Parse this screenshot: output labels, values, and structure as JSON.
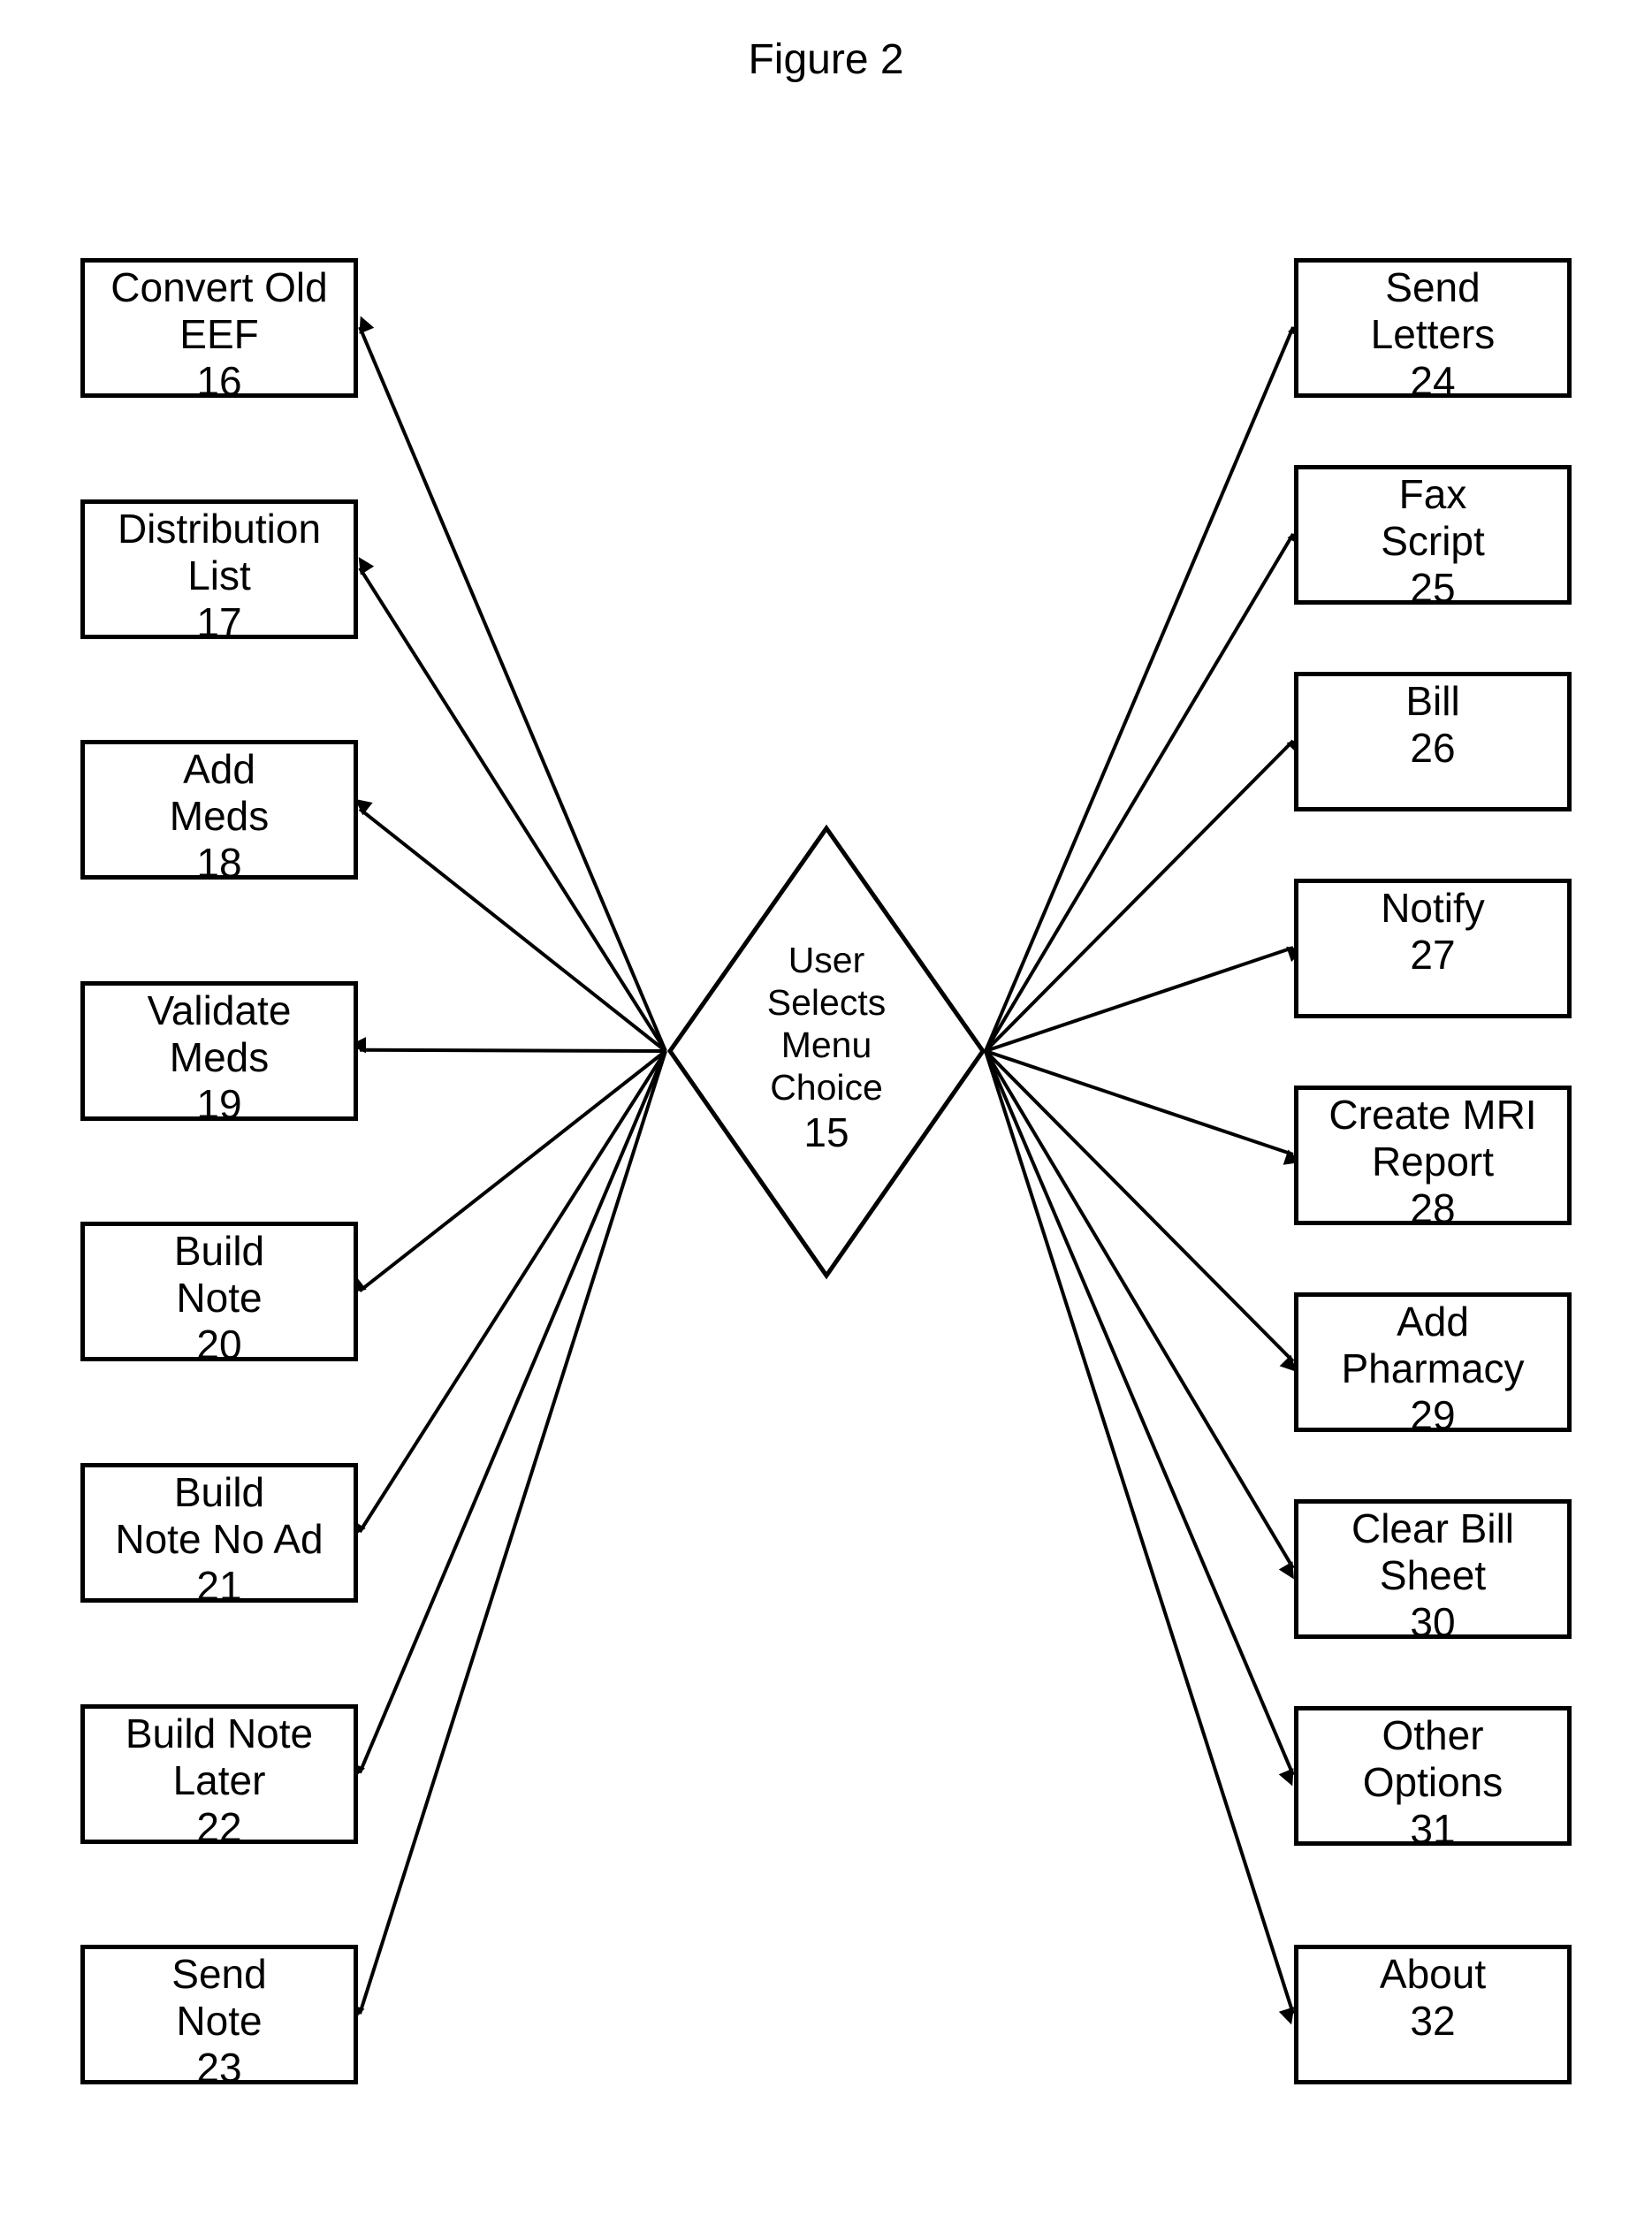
{
  "title": "Figure 2",
  "decision": {
    "lines": [
      "User",
      "Selects",
      "Menu",
      "Choice"
    ],
    "number": "15"
  },
  "left_boxes": [
    {
      "lines": [
        "Convert Old",
        "EEF"
      ],
      "number": "16"
    },
    {
      "lines": [
        "Distribution",
        "List"
      ],
      "number": "17"
    },
    {
      "lines": [
        "Add",
        "Meds"
      ],
      "number": "18"
    },
    {
      "lines": [
        "Validate",
        "Meds"
      ],
      "number": "19"
    },
    {
      "lines": [
        "Build",
        "Note"
      ],
      "number": "20"
    },
    {
      "lines": [
        "Build",
        "Note No Ad"
      ],
      "number": "21"
    },
    {
      "lines": [
        "Build Note",
        "Later"
      ],
      "number": "22"
    },
    {
      "lines": [
        "Send",
        "Note"
      ],
      "number": "23"
    }
  ],
  "right_boxes": [
    {
      "lines": [
        "Send",
        "Letters"
      ],
      "number": "24"
    },
    {
      "lines": [
        "Fax",
        "Script"
      ],
      "number": "25"
    },
    {
      "lines": [
        "Bill"
      ],
      "number": "26"
    },
    {
      "lines": [
        "Notify"
      ],
      "number": "27"
    },
    {
      "lines": [
        "Create MRI",
        "Report"
      ],
      "number": "28"
    },
    {
      "lines": [
        "Add",
        "Pharmacy"
      ],
      "number": "29"
    },
    {
      "lines": [
        "Clear Bill",
        "Sheet"
      ],
      "number": "30"
    },
    {
      "lines": [
        "Other",
        "Options"
      ],
      "number": "31"
    },
    {
      "lines": [
        "About"
      ],
      "number": "32"
    }
  ],
  "edges": {
    "from": "15",
    "to": [
      "16",
      "17",
      "18",
      "19",
      "20",
      "21",
      "22",
      "23",
      "24",
      "25",
      "26",
      "27",
      "28",
      "29",
      "30",
      "31",
      "32"
    ]
  },
  "colors": {
    "stroke": "#000000",
    "background": "#ffffff"
  }
}
